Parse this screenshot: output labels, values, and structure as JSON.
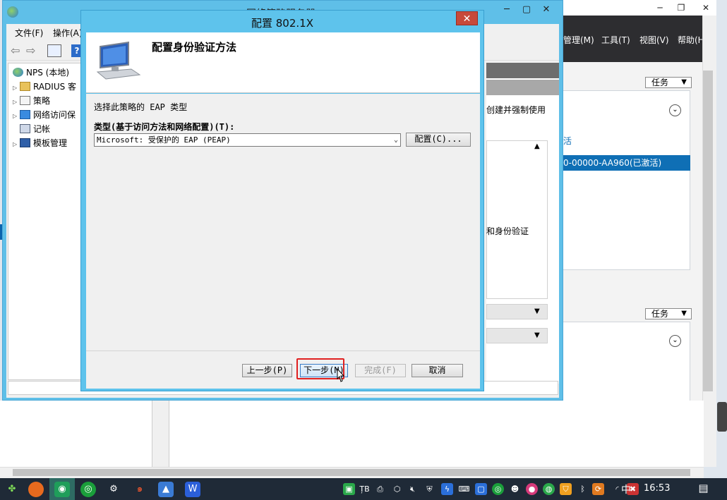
{
  "server_manager": {
    "menu_manage": "管理(M)",
    "menu_tools": "工具(T)",
    "menu_view": "视图(V)",
    "menu_help": "帮助(H",
    "tasks_label": "任务",
    "text_create_enforce": "创建并强制使用",
    "link_activate": "活",
    "selected_row": "0-00000-AA960(已激活)",
    "text_auth": "和身份验证"
  },
  "nps": {
    "title": "网络策略服务器",
    "menu_file": "文件(F)",
    "menu_action": "操作(A)",
    "tree": [
      {
        "label": "NPS (本地)",
        "expand": ""
      },
      {
        "label": "RADIUS 客",
        "expand": "▷"
      },
      {
        "label": "策略",
        "expand": "▷"
      },
      {
        "label": "网络访问保",
        "expand": "▷"
      },
      {
        "label": "记帐",
        "expand": ""
      },
      {
        "label": "模板管理",
        "expand": "▷"
      }
    ]
  },
  "dialog": {
    "title": "配置 802.1X",
    "heading": "配置身份验证方法",
    "description": "选择此策略的 EAP 类型",
    "type_label": "类型(基于访问方法和网络配置)(T):",
    "type_value": "Microsoft: 受保护的 EAP (PEAP)",
    "configure_button": "配置(C)...",
    "back_button": "上一步(P)",
    "next_button": "下一步(N)",
    "finish_button": "完成(F)",
    "cancel_button": "取消"
  },
  "taskbar": {
    "ime": "中",
    "clock": "16:53"
  }
}
